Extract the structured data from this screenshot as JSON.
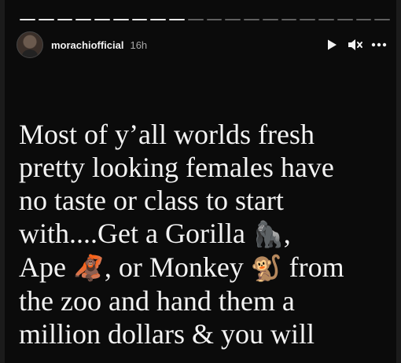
{
  "progress": {
    "segments_total": 20,
    "segments_viewed": 9
  },
  "header": {
    "username": "morachiofficial",
    "timestamp": "16h",
    "icons": {
      "play": "play-icon",
      "mute": "speaker-muted-icon",
      "more": "more-dots-icon"
    }
  },
  "caption": {
    "lines": [
      "Most of y’all worlds fresh",
      "pretty looking females have",
      "no taste or class to start",
      "with....Get a Gorilla",
      "Ape",
      ", or Monkey",
      "from",
      "the zoo and hand them a",
      "million dollars & you will"
    ],
    "emojis": {
      "gorilla": "🦍",
      "orangutan": "🦧",
      "monkey": "🐒"
    }
  },
  "colors": {
    "background": "#0b0b0b",
    "text": "#f3f3f3",
    "timestamp": "#a8a8a8"
  }
}
